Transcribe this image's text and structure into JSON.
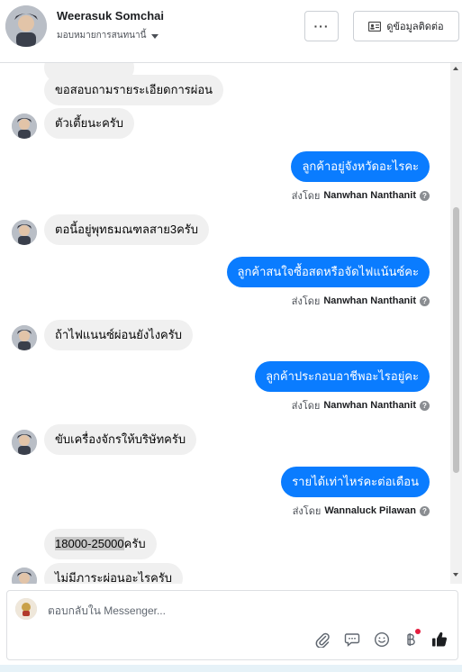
{
  "header": {
    "name": "Weerasuk Somchai",
    "assign_label": "มอบหมายการสนทนานี้",
    "more_label": "···",
    "contact_label": "ดูข้อมูลติดต่อ"
  },
  "messages": {
    "in_0": "ขอสอบถามรายระเอียดการผ่อน",
    "in_1": "ตัวเตี้ยนะครับ",
    "out_0": "ลูกค้าอยู่จังหวัดอะไรคะ",
    "sent_by_label": "ส่งโดย",
    "out_0_sender": "Nanwhan Nanthanit",
    "in_2": "ตอนี้อยู่พุทธมณฑลสาย3ครับ",
    "out_1": "ลูกค้าสนใจซื้อสดหรือจัดไฟแน้นซ์คะ",
    "out_1_sender": "Nanwhan Nanthanit",
    "in_3": "ถ้าไฟแนนซ์ผ่อนยังไงครับ",
    "out_2": "ลูกค้าประกอบอาชีพอะไรอยู่คะ",
    "out_2_sender": "Nanwhan Nanthanit",
    "in_4": "ขับเครื่องจักรให้บริษัทครับ",
    "out_3": "รายได้เท่าไหร่คะต่อเดือน",
    "out_3_sender": "Wannaluck Pilawan",
    "in_5_highlight": "18000-25000",
    "in_5_rest": "ครับ",
    "in_6": "ไม่มีภาระผ่อนอะไรครับ"
  },
  "composer": {
    "placeholder": "ตอบกลับใน Messenger..."
  },
  "icons": {
    "more": "ellipsis-icon",
    "contact": "contact-card-icon",
    "info": "info-icon",
    "attach": "paperclip-icon",
    "saved_reply": "speech-bubble-icon",
    "emoji": "smiley-icon",
    "payment": "baht-icon",
    "like": "thumbs-up-icon"
  },
  "colors": {
    "outgoing_bubble": "#0a7cff",
    "incoming_bubble": "#f0f0f0",
    "notification_dot": "#e41e3f"
  }
}
